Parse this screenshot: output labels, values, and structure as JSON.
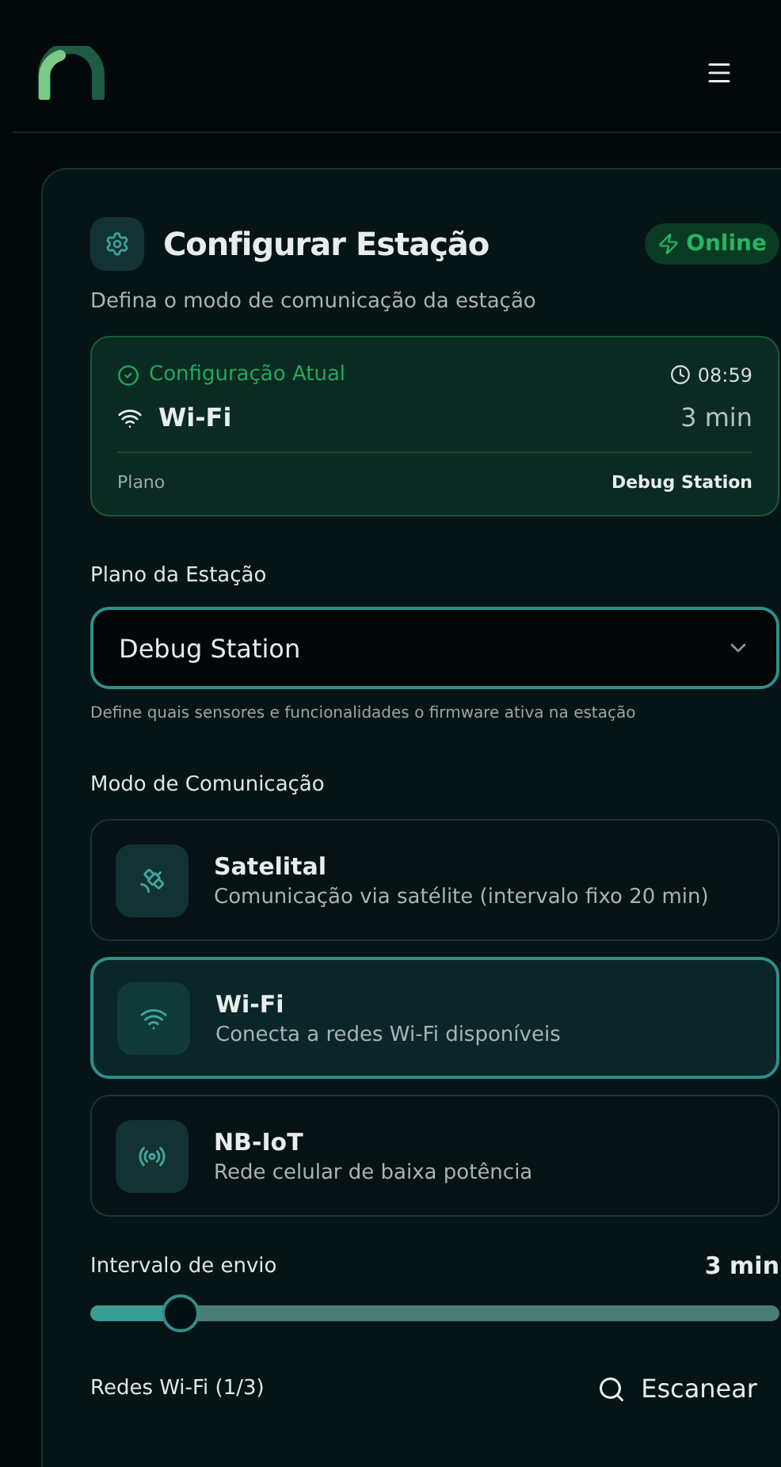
{
  "card": {
    "title": "Configurar Estação",
    "status": "Online",
    "online": true,
    "subtitle": "Defina o modo de comunicação da estação",
    "current": {
      "label": "Configuração Atual",
      "time": "08:59",
      "mode": "Wi-Fi",
      "interval": "3 min",
      "plan_label": "Plano",
      "plan_value": "Debug Station"
    },
    "plan": {
      "label": "Plano da Estação",
      "value": "Debug Station",
      "hint": "Define quais sensores e funcionalidades o firmware ativa na estação"
    },
    "modes_label": "Modo de Comunicação",
    "modes": [
      {
        "kind": "satellite",
        "title": "Satelital",
        "description": "Comunicação via satélite (intervalo fixo 20 min)",
        "selected": false
      },
      {
        "kind": "wifi",
        "title": "Wi-Fi",
        "description": "Conecta a redes Wi-Fi disponíveis",
        "selected": true
      },
      {
        "kind": "cellular",
        "title": "NB-IoT",
        "description": "Rede celular de baixa potência",
        "selected": false
      }
    ],
    "interval": {
      "label": "Intervalo de envio",
      "reading": "3 min",
      "level": 0.13
    },
    "networks": {
      "label": "Redes Wi-Fi (1/3)",
      "scan": "Escanear"
    }
  }
}
